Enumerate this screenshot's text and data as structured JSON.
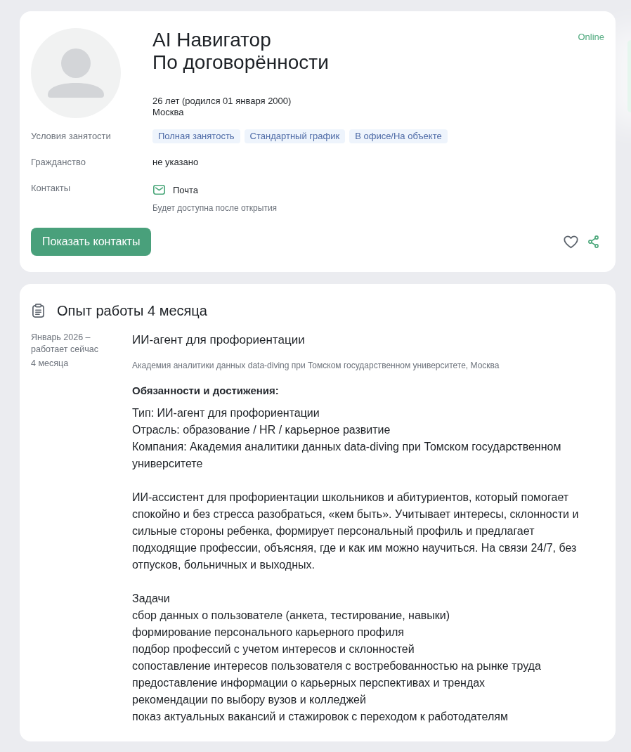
{
  "profile": {
    "name": "AI Навигатор",
    "salary": "По договорённости",
    "age": "26 лет (родился 01 января 2000)",
    "city": "Москва",
    "status": "Online"
  },
  "details": [
    {
      "kind": "tags",
      "label": "Условия занятости",
      "tags": [
        "Полная занятость",
        "Стандартный график",
        "В офисе/На объекте"
      ]
    },
    {
      "kind": "text",
      "label": "Гражданство",
      "value": "не указано"
    },
    {
      "kind": "contact",
      "label": "Контакты",
      "contact": "Почта",
      "note": "Будет доступна после открытия"
    }
  ],
  "actions": {
    "primary_button": "Показать контакты"
  },
  "experience": {
    "title": "Опыт работы 4 месяца",
    "jobs": [
      {
        "period": "Январь 2026 – работает сейчас",
        "duration": "4 месяца",
        "position": "ИИ-агент для профориентации",
        "company": "Академия аналитики данных data-diving при Томском государственном университете, Москва",
        "section_title": "Обязанности и достижения:",
        "blocks": [
          [
            "Тип: ИИ-агент для профориентации",
            "Отрасль: образование / HR / карьерное развитие",
            "Компания: Академия аналитики данных data-diving при Томском государственном университете"
          ],
          [
            "ИИ-ассистент для профориентации школьников и абитуриентов, который помогает спокойно и без стресса разобраться, «кем быть». Учитывает интересы, склонности и сильные стороны ребенка, формирует персональный профиль и предлагает подходящие профессии, объясняя, где и как им можно научиться. На связи 24/7, без отпусков, больничных и выходных."
          ],
          [
            "Задачи",
            "сбор данных о пользователе (анкета, тестирование, навыки)",
            "формирование персонального карьерного профиля",
            "подбор профессий с учетом интересов и склонностей",
            "сопоставление интересов пользователя с востребованностью на рынке труда",
            "предоставление информации о карьерных перспективах и трендах",
            "рекомендации по выбору вузов и колледжей",
            "показ актуальных вакансий и стажировок с переходом к работодателям"
          ]
        ]
      }
    ]
  }
}
